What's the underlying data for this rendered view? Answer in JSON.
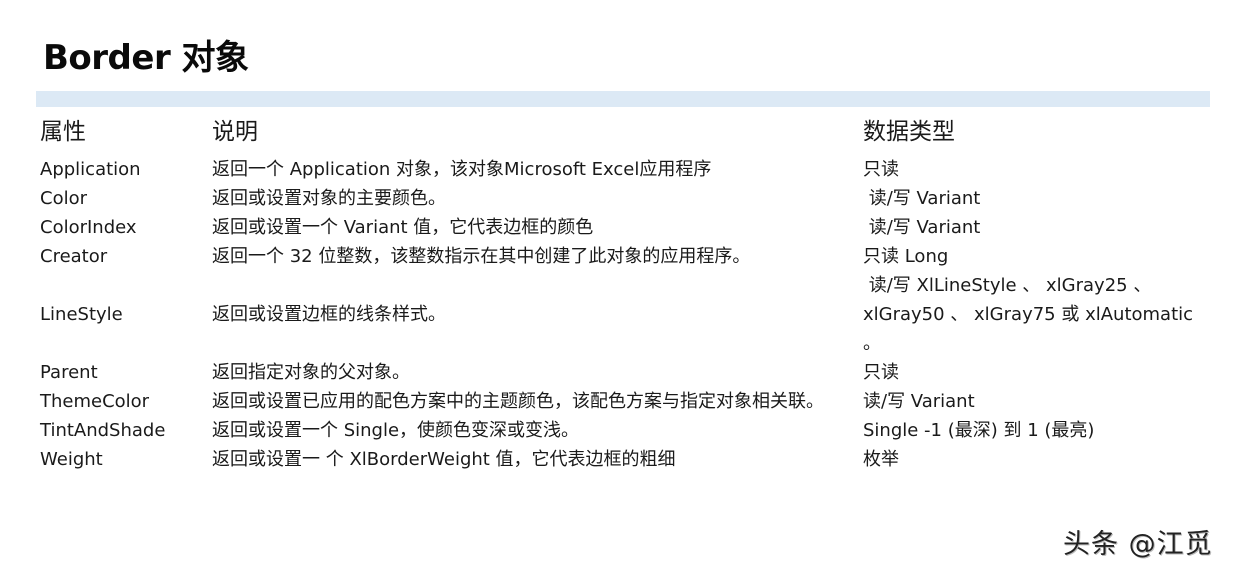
{
  "title": "Border 对象",
  "headers": {
    "property": "属性",
    "description": "说明",
    "data_type": "数据类型"
  },
  "rows": [
    {
      "property": "Application",
      "description": "返回一个 Application 对象，该对象Microsoft Excel应用程序",
      "data_type": "只读"
    },
    {
      "property": "Color",
      "description": "返回或设置对象的主要颜色。",
      "data_type": " 读/写 Variant"
    },
    {
      "property": "ColorIndex",
      "description": "返回或设置一个 Variant 值，它代表边框的颜色",
      "data_type": " 读/写 Variant"
    },
    {
      "property": "Creator",
      "description": "返回一个 32 位整数，该整数指示在其中创建了此对象的应用程序。",
      "data_type": "只读 Long"
    },
    {
      "property": "LineStyle",
      "description": "返回或设置边框的线条样式。",
      "data_type_lines": [
        " 读/写 XlLineStyle 、 xlGray25 、",
        "xlGray50 、 xlGray75 或 xlAutomatic",
        "。"
      ]
    },
    {
      "property": "Parent",
      "description": "返回指定对象的父对象。",
      "data_type": "只读"
    },
    {
      "property": "ThemeColor",
      "description": "返回或设置已应用的配色方案中的主题颜色，该配色方案与指定对象相关联。",
      "data_type": "读/写 Variant"
    },
    {
      "property": "TintAndShade",
      "description": "返回或设置一个 Single，使颜色变深或变浅。",
      "data_type": "Single -1 (最深) 到 1 (最亮)"
    },
    {
      "property": "Weight",
      "description": "返回或设置一 个 XlBorderWeight 值，它代表边框的粗细",
      "data_type": "枚举"
    }
  ],
  "watermark": "头条 @江觅",
  "colors": {
    "band": "#dce9f5",
    "text": "#1a1a1a"
  }
}
